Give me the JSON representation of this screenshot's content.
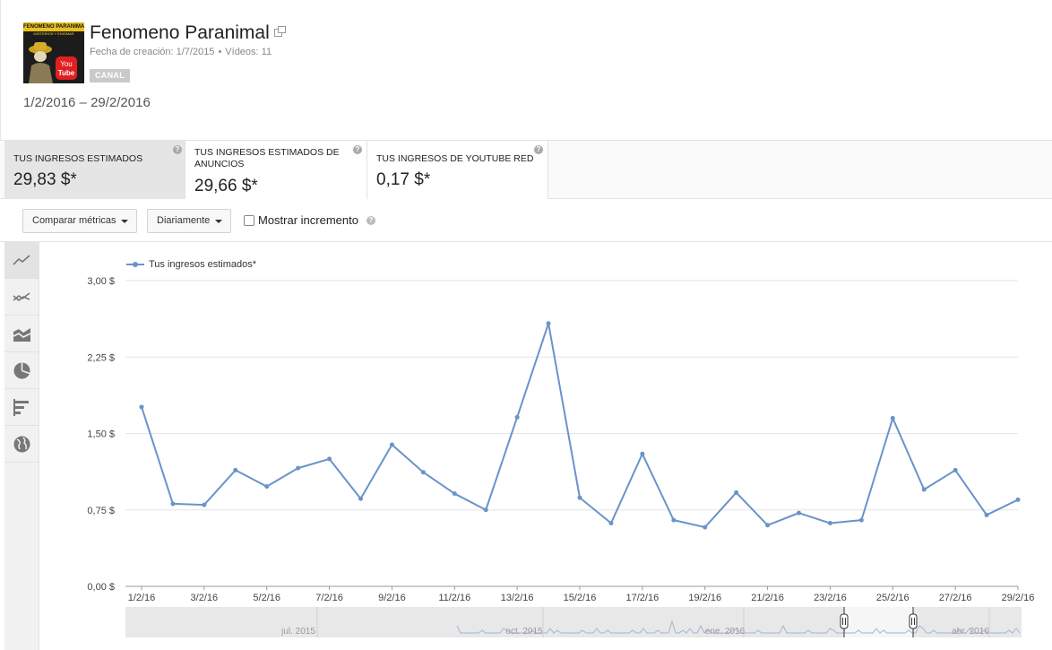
{
  "channel": {
    "title": "Fenomeno Paranimal",
    "thumb_band": "FENOMENO PARANIMAL",
    "thumb_subtitle": "MISTERIOS Y ENIGMAS",
    "created_label": "Fecha de creación: 1/7/2015",
    "videos_label": "Vídeos: 11",
    "badge": "CANAL"
  },
  "date_range": "1/2/2016 – 29/2/2016",
  "metrics": [
    {
      "label": "Tus ingresos estimados",
      "value": "29,83 $*",
      "selected": true
    },
    {
      "label": "Tus ingresos estimados de anuncios",
      "value": "29,66 $*",
      "selected": false
    },
    {
      "label": "Tus ingresos de YouTube Red",
      "value": "0,17 $*",
      "selected": false
    }
  ],
  "toolbar": {
    "compare_label": "Comparar métricas",
    "interval_label": "Diariamente",
    "growth_label": "Mostrar incremento",
    "growth_checked": false
  },
  "sidebar": {
    "buttons": [
      {
        "icon": "line-chart-icon",
        "active": true
      },
      {
        "icon": "multi-line-chart-icon",
        "active": false
      },
      {
        "icon": "area-chart-icon",
        "active": false
      },
      {
        "icon": "pie-chart-icon",
        "active": false
      },
      {
        "icon": "bar-chart-icon",
        "active": false
      },
      {
        "icon": "globe-map-icon",
        "active": false
      }
    ]
  },
  "chart_data": {
    "type": "line",
    "series": [
      {
        "name": "Tus ingresos estimados*",
        "color": "#6a93c9",
        "values": [
          1.76,
          0.81,
          0.8,
          1.14,
          0.98,
          1.16,
          1.25,
          0.86,
          1.39,
          1.12,
          0.91,
          0.75,
          1.66,
          2.58,
          0.87,
          0.62,
          1.3,
          0.65,
          0.58,
          0.92,
          0.6,
          0.72,
          0.62,
          0.65,
          1.65,
          0.95,
          1.14,
          0.7,
          0.85
        ]
      }
    ],
    "x": [
      "1/2/16",
      "2/2/16",
      "3/2/16",
      "4/2/16",
      "5/2/16",
      "6/2/16",
      "7/2/16",
      "8/2/16",
      "9/2/16",
      "10/2/16",
      "11/2/16",
      "12/2/16",
      "13/2/16",
      "14/2/16",
      "15/2/16",
      "16/2/16",
      "17/2/16",
      "18/2/16",
      "19/2/16",
      "20/2/16",
      "21/2/16",
      "22/2/16",
      "23/2/16",
      "24/2/16",
      "25/2/16",
      "26/2/16",
      "27/2/16",
      "28/2/16",
      "29/2/16"
    ],
    "x_tick_labels": [
      "1/2/16",
      "3/2/16",
      "5/2/16",
      "7/2/16",
      "9/2/16",
      "11/2/16",
      "13/2/16",
      "15/2/16",
      "17/2/16",
      "19/2/16",
      "21/2/16",
      "23/2/16",
      "25/2/16",
      "27/2/16",
      "29/2/16"
    ],
    "y_ticks": [
      0,
      0.75,
      1.5,
      2.25,
      3.0
    ],
    "y_tick_labels": [
      "0,00 $",
      "0,75 $",
      "1,50 $",
      "2,25 $",
      "3,00 $"
    ],
    "ylim": [
      0,
      3.0
    ],
    "grid": true,
    "legend": "top-left",
    "navigator": {
      "labels": [
        "jul. 2015",
        "oct. 2015",
        "ene. 2016",
        "abr. 2016"
      ],
      "selection": [
        "1/2/16",
        "29/2/16"
      ]
    }
  }
}
